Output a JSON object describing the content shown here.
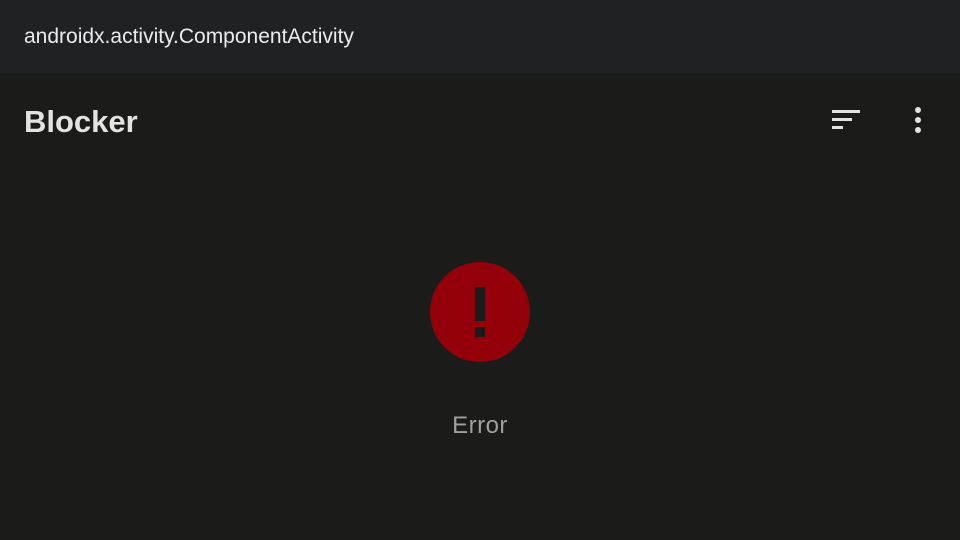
{
  "window": {
    "title": "androidx.activity.ComponentActivity"
  },
  "app_bar": {
    "title": "Blocker",
    "actions": [
      {
        "icon": "sort-icon"
      },
      {
        "icon": "more-vert-icon"
      }
    ]
  },
  "content": {
    "state": "error",
    "icon": "error-icon",
    "message": "Error"
  },
  "colors": {
    "background": "#1b1c1a",
    "title_bar": "#1f2125",
    "error_red": "#93000a",
    "text_primary": "#e3e3e0",
    "text_secondary": "#9fa19c"
  }
}
